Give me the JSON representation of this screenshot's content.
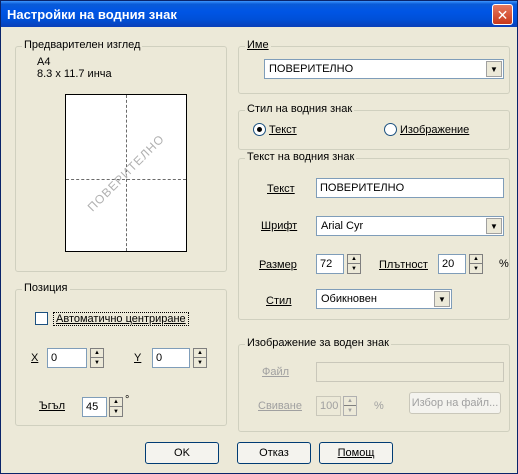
{
  "window": {
    "title": "Настройки на водния знак",
    "close_glyph": "✕"
  },
  "preview": {
    "legend": "Предварителен изглед",
    "paper": "A4",
    "size": "8.3 x 11.7 инча",
    "watermark_text": "ПОВЕРИТЕЛНО"
  },
  "position": {
    "legend": "Позиция",
    "auto_center_label": "Автоматично центриране",
    "auto_center_checked": false,
    "x_label": "X",
    "x_value": "0",
    "y_label": "Y",
    "y_value": "0",
    "angle_label": "Ъгъл",
    "angle_value": "45",
    "angle_unit": "°"
  },
  "name": {
    "legend": "Име",
    "selected": "ПОВЕРИТЕЛНО"
  },
  "style": {
    "legend": "Стил на водния знак",
    "text_label": "Текст",
    "image_label": "Изображение",
    "selected": "text"
  },
  "text_group": {
    "legend": "Текст на водния знак",
    "text_label": "Текст",
    "text_value": "ПОВЕРИТЕЛНО",
    "font_label": "Шрифт",
    "font_value": "Arial Cyr",
    "size_label": "Размер",
    "size_value": "72",
    "density_label": "Плътност",
    "density_value": "20",
    "percent": "%",
    "style_label": "Стил",
    "style_value": "Обикновен"
  },
  "image_group": {
    "legend": "Изображение за воден знак",
    "file_label": "Файл",
    "file_value": "",
    "scale_label": "Свиване",
    "scale_value": "100",
    "percent": "%",
    "browse_label": "Избор на файл..."
  },
  "buttons": {
    "ok": "OK",
    "cancel": "Отказ",
    "help": "Помощ"
  },
  "icons": {
    "dropdown": "▼",
    "spin_up": "▲",
    "spin_down": "▼"
  }
}
